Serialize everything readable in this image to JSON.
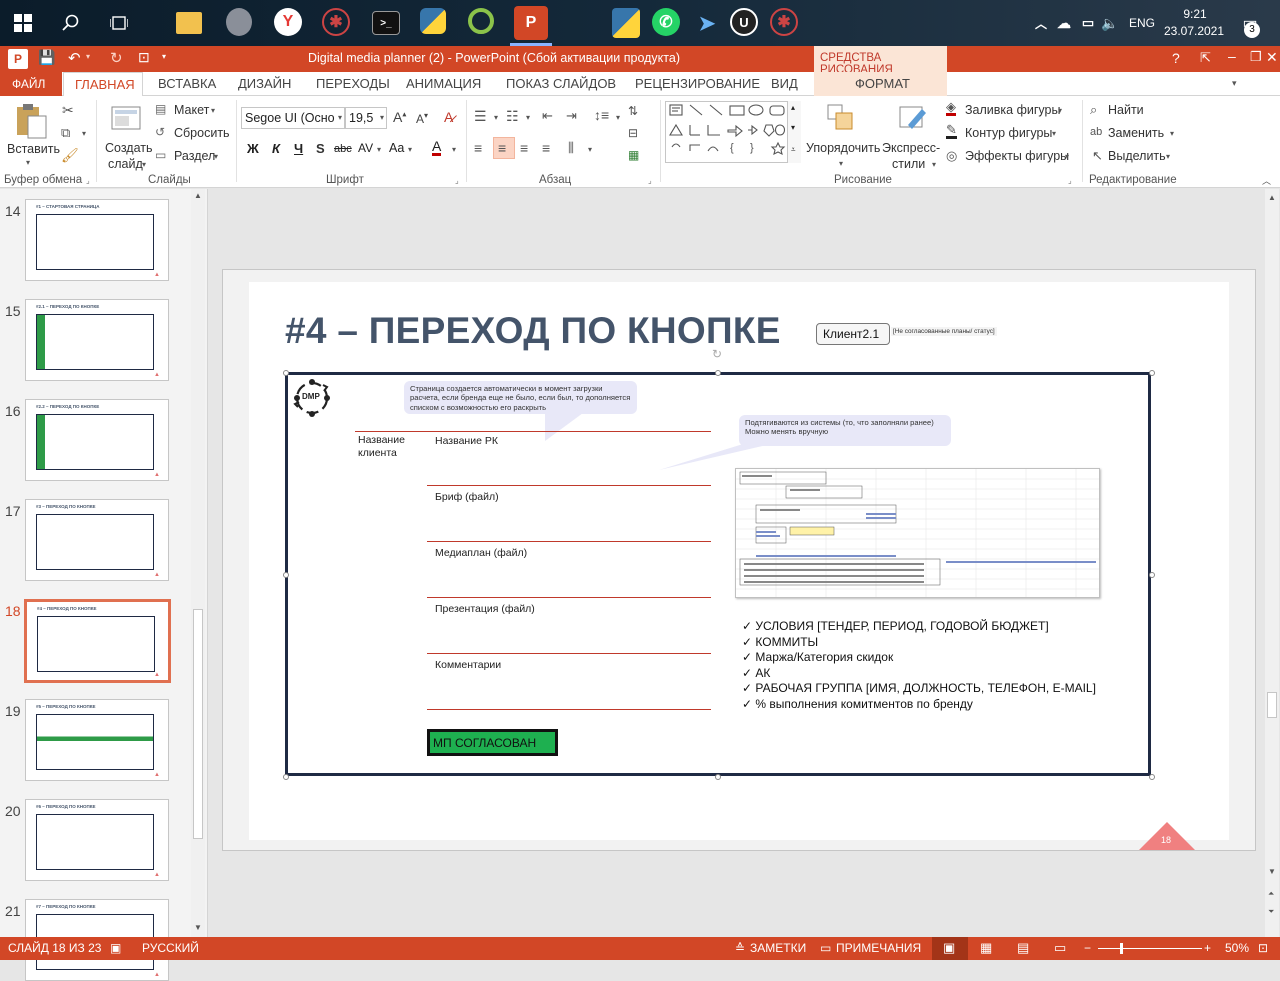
{
  "taskbar": {
    "time": "9:21",
    "date": "23.07.2021",
    "lang": "ENG",
    "notifications": "3"
  },
  "titlebar": {
    "title": "Digital media planner (2) -  PowerPoint (Сбой активации продукта)",
    "context_label": "СРЕДСТВА РИСОВАНИЯ"
  },
  "tabs": {
    "file": "ФАЙЛ",
    "home": "ГЛАВНАЯ",
    "insert": "ВСТАВКА",
    "design": "ДИЗАЙН",
    "transitions": "ПЕРЕХОДЫ",
    "animation": "АНИМАЦИЯ",
    "slideshow": "ПОКАЗ СЛАЙДОВ",
    "review": "РЕЦЕНЗИРОВАНИЕ",
    "view": "ВИД",
    "format": "ФОРМАТ"
  },
  "ribbon": {
    "paste": "Вставить",
    "clipboard_group": "Буфер обмена",
    "new_slide_1": "Создать",
    "new_slide_2": "слайд",
    "layout": "Макет",
    "reset": "Сбросить",
    "section": "Раздел",
    "slides_group": "Слайды",
    "font_name": "Segoe UI (Основ",
    "font_size": "19,5",
    "font_group": "Шрифт",
    "paragraph_group": "Абзац",
    "arrange": "Упорядочить",
    "quick_styles_1": "Экспресс-",
    "quick_styles_2": "стили",
    "shape_fill": "Заливка фигуры",
    "shape_outline": "Контур фигуры",
    "shape_effects": "Эффекты фигуры",
    "drawing_group": "Рисование",
    "find": "Найти",
    "replace": "Заменить",
    "select": "Выделить",
    "editing_group": "Редактирование"
  },
  "thumbnails": [
    {
      "num": "14",
      "title": "#1 – СТАРТОВАЯ СТРАНИЦА"
    },
    {
      "num": "15",
      "title": "#2.1 – ПЕРЕХОД ПО КНОПКЕ"
    },
    {
      "num": "16",
      "title": "#2.2 – ПЕРЕХОД ПО КНОПКЕ"
    },
    {
      "num": "17",
      "title": "#3 – ПЕРЕХОД ПО КНОПКЕ"
    },
    {
      "num": "18",
      "title": "#4 – ПЕРЕХОД ПО КНОПКЕ"
    },
    {
      "num": "19",
      "title": "#5 – ПЕРЕХОД ПО КНОПКЕ"
    },
    {
      "num": "20",
      "title": "#6 – ПЕРЕХОД ПО КНОПКЕ"
    },
    {
      "num": "21",
      "title": "#7 – ПЕРЕХОД ПО КНОПКЕ"
    }
  ],
  "slide": {
    "title": "#4 – ПЕРЕХОД ПО КНОПКЕ",
    "client_box": "Клиент2.1",
    "status_note": "[Не согласованные планы/ статус]",
    "logo": "DMP",
    "bubble1": "Страница создается автоматически в момент загрузки расчета, если бренда еще не было, если был, то дополняется списком с возможностью его раскрыть",
    "bubble2": "Подтягиваются из системы (то, что заполняли ранее) Можно менять вручную",
    "client_name": "Название клиента",
    "fields": [
      "Название РК",
      "Бриф (файл)",
      "Медиаплан (файл)",
      "Презентация (файл)",
      "Комментарии"
    ],
    "approved_button": "МП СОГЛАСОВАН",
    "checklist": [
      "УСЛОВИЯ [ТЕНДЕР, ПЕРИОД, ГОДОВОЙ БЮДЖЕТ]",
      "КОММИТЫ",
      "Маржа/Категория скидок",
      "АК",
      "РАБОЧАЯ ГРУППА [ИМЯ, ДОЛЖНОСТЬ, ТЕЛЕФОН, E-MAIL]",
      "% выполнения комитментов по бренду"
    ],
    "page_number": "18"
  },
  "status": {
    "slide": "СЛАЙД 18 ИЗ 23",
    "language": "РУССКИЙ",
    "notes": "ЗАМЕТКИ",
    "comments": "ПРИМЕЧАНИЯ",
    "zoom": "50%"
  },
  "colors": {
    "accent": "#d24726",
    "title": "#44546a",
    "button_fill": "#1eb050"
  }
}
